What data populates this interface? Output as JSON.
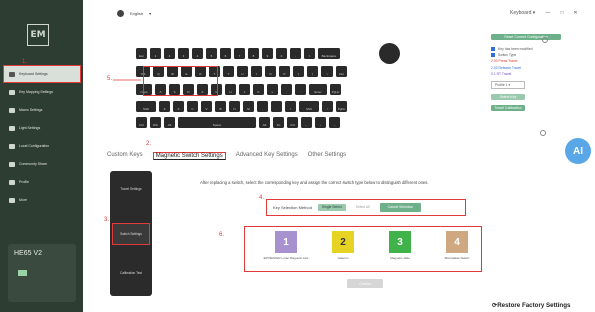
{
  "logo": "EM",
  "sidebar": {
    "items": [
      {
        "label": "Keyboard Settings"
      },
      {
        "label": "Key Mapping Settings"
      },
      {
        "label": "Macro Settings"
      },
      {
        "label": "Light Settings"
      },
      {
        "label": "Local Configuration"
      },
      {
        "label": "Community Share"
      },
      {
        "label": "Profile"
      },
      {
        "label": "More"
      }
    ],
    "model": "HE65 V2"
  },
  "annotations": [
    "1.",
    "2.",
    "3.",
    "4.",
    "5.",
    "6."
  ],
  "topbar": {
    "language": "English",
    "device": "Keyboard",
    "controls": [
      "—",
      "□",
      "✕"
    ]
  },
  "keyboard": {
    "rows": [
      [
        "Esc",
        "1",
        "2",
        "3",
        "4",
        "5",
        "6",
        "7",
        "8",
        "9",
        "0",
        "-",
        "=",
        "Backspace"
      ],
      [
        "Tab",
        "Q",
        "W",
        "E",
        "R",
        "T",
        "Y",
        "U",
        "I",
        "O",
        "P",
        "[",
        "]",
        "\\",
        "Del"
      ],
      [
        "Caps",
        "A",
        "S",
        "D",
        "F",
        "G",
        "H",
        "J",
        "K",
        "L",
        ";",
        "'",
        "Enter",
        "PgUp"
      ],
      [
        "Shift",
        "Z",
        "X",
        "C",
        "V",
        "B",
        "N",
        "M",
        ",",
        ".",
        "/",
        "Shift",
        "↑",
        "PgDn"
      ],
      [
        "Ctrl",
        "Win",
        "Alt",
        "Space",
        "Alt",
        "Fn",
        "Ctrl",
        "←",
        "↓",
        "→"
      ]
    ]
  },
  "right_panel": {
    "reset_button": "Reset Current Configuration",
    "legend": [
      {
        "label": "Key has been modified",
        "color": "#2f6fd6"
      },
      {
        "label": "Switch Type",
        "color": "#2f6fd6"
      },
      {
        "label": "2.00  Press Travel",
        "color": "#d8362d"
      },
      {
        "label": "2.00  Release Travel",
        "color": "#2f6fd6"
      },
      {
        "label": "0.1  RT Travel",
        "color": "#6b4cc7"
      }
    ],
    "select_value": "Profile 1",
    "select_button": "Select Key",
    "travel_button": "Travel Calibration"
  },
  "tabs": [
    "Custom Keys",
    "Magnetic Switch Settings",
    "Advanced Key Settings",
    "Other Settings"
  ],
  "inner_nav": [
    "Travel Settings",
    "Switch Settings",
    "Calibration Test"
  ],
  "instruction": "After replacing a switch, select the corresponding key and assign the correct switch type below to distinguish different ones.",
  "method": {
    "label": "Key Selection Method",
    "single": "Single Select",
    "all": "Select All",
    "cancel": "Cancel Selection"
  },
  "switch_types": [
    {
      "num": "1",
      "label": "EPOMAKER Lunar Magnetic Axis",
      "color": "#a792cf"
    },
    {
      "num": "2",
      "label": "Gateron",
      "color": "#e7d324"
    },
    {
      "num": "3",
      "label": "Magnetic Jade",
      "color": "#3fb34a"
    },
    {
      "num": "4",
      "label": "Marmalade Switch",
      "color": "#cfa882"
    }
  ],
  "confirm": "Confirm",
  "ai_badge": "AI",
  "restore": "Restore Factory Settings"
}
